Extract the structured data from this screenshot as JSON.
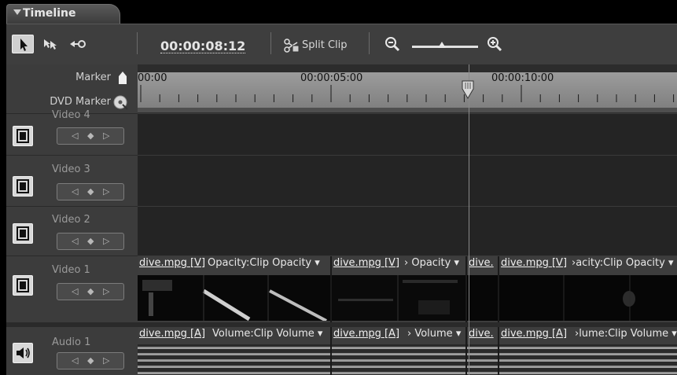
{
  "panel": {
    "tab_label": "Timeline"
  },
  "toolbar": {
    "timecode": "00:00:08:12",
    "split_clip_label": "Split Clip",
    "tools": [
      "selection-tool",
      "track-select-tool",
      "ripple-edit-tool"
    ],
    "zoom_level": 0.45
  },
  "ruler": {
    "marker_label": "Marker",
    "dvd_marker_label": "DVD Marker",
    "times": [
      "00:00",
      "00:00:05:00",
      "00:00:10:00"
    ]
  },
  "tracks": [
    {
      "name": "Video 4"
    },
    {
      "name": "Video 3"
    },
    {
      "name": "Video 2"
    },
    {
      "name": "Video 1"
    },
    {
      "name": "Audio 1"
    }
  ],
  "video_clips": [
    {
      "name": "dive.mpg [V]",
      "effect": "Opacity:Clip Opacity ▾"
    },
    {
      "name": "dive.mpg [V]",
      "effect": "› Opacity ▾"
    },
    {
      "name": "dive.",
      "effect": ""
    },
    {
      "name": "dive.mpg [V]",
      "effect": "›acity:Clip Opacity ▾"
    }
  ],
  "audio_clips": [
    {
      "name": "dive.mpg [A]",
      "effect": "Volume:Clip Volume ▾"
    },
    {
      "name": "dive.mpg [A]",
      "effect": "› Volume ▾"
    },
    {
      "name": "dive.",
      "effect": ""
    },
    {
      "name": "dive.mpg [A]",
      "effect": "›lume:Clip Volume ▾"
    }
  ],
  "colors": {
    "panel": "#3c3c3c",
    "lane": "#242424",
    "ruler": "#8e8e8e"
  }
}
